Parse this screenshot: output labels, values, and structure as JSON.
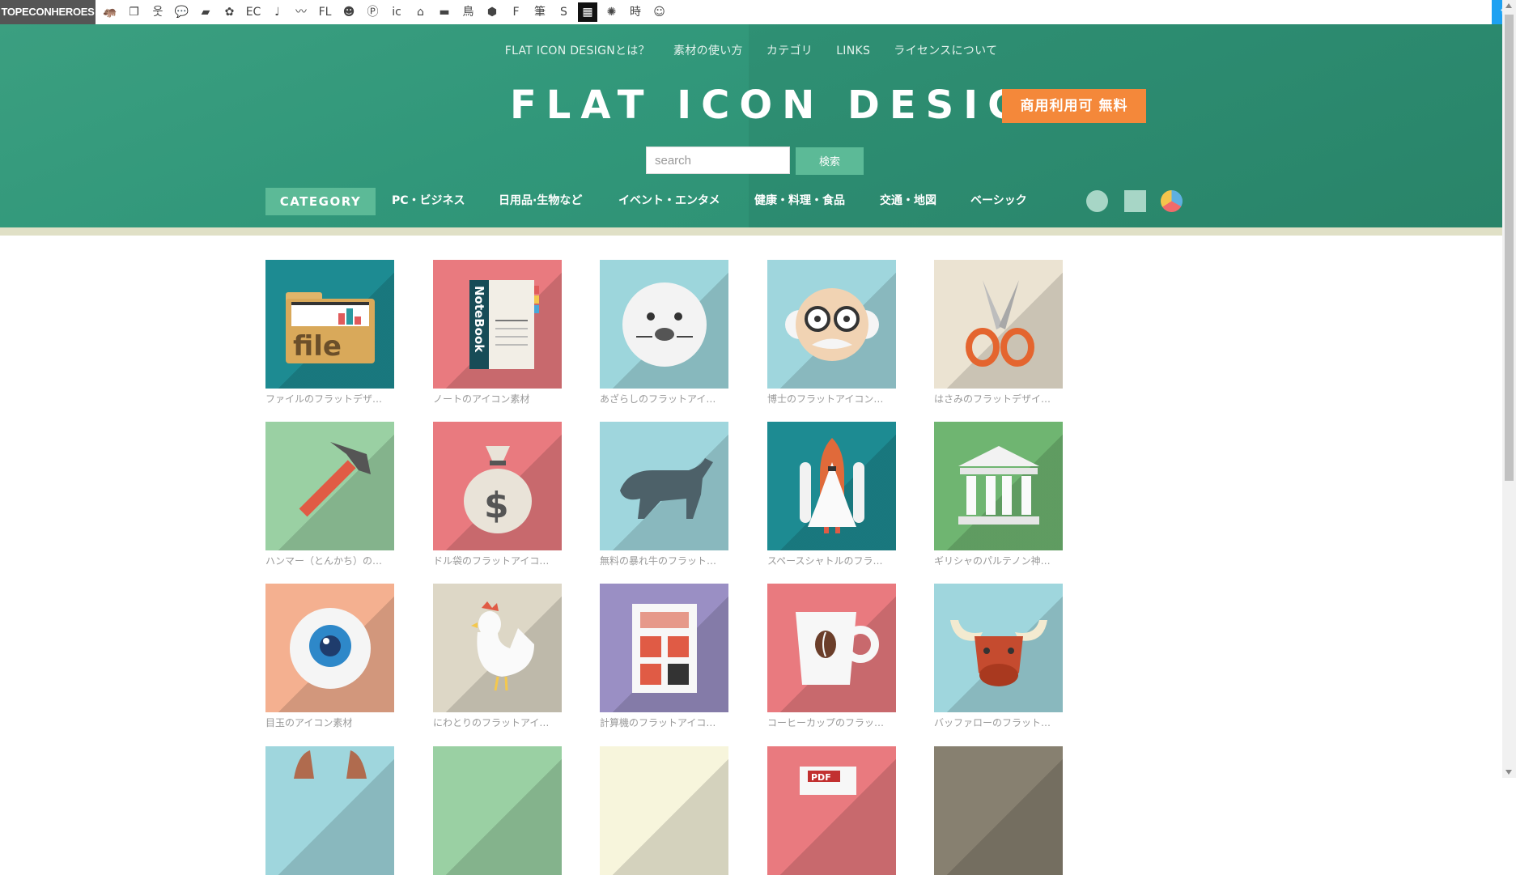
{
  "topbar": {
    "brand": "TOPECONHEROES",
    "icons": [
      {
        "name": "hippo-icon",
        "glyph": "🦛"
      },
      {
        "name": "copy-icon",
        "glyph": "❐"
      },
      {
        "name": "person-icon",
        "glyph": "웃"
      },
      {
        "name": "speech-bubble-icon",
        "glyph": "💬"
      },
      {
        "name": "card-icon",
        "glyph": "▰"
      },
      {
        "name": "flower-icon",
        "glyph": "✿"
      },
      {
        "name": "ec-icon",
        "glyph": "EC"
      },
      {
        "name": "music-note-icon",
        "glyph": "♩"
      },
      {
        "name": "line-icon",
        "glyph": "〰"
      },
      {
        "name": "flat-icon",
        "glyph": "FL"
      },
      {
        "name": "smiley-icon",
        "glyph": "☻"
      },
      {
        "name": "p-icon",
        "glyph": "Ⓟ"
      },
      {
        "name": "icon-text-icon",
        "glyph": "ic"
      },
      {
        "name": "building-icon",
        "glyph": "⌂"
      },
      {
        "name": "sofa-icon",
        "glyph": "▬"
      },
      {
        "name": "bird-icon",
        "glyph": "鳥"
      },
      {
        "name": "hexagon-icon",
        "glyph": "⬢"
      },
      {
        "name": "f-icon",
        "glyph": "F"
      },
      {
        "name": "brush-icon",
        "glyph": "筆"
      },
      {
        "name": "s-icon",
        "glyph": "S"
      },
      {
        "name": "grid-icon",
        "glyph": "▦"
      },
      {
        "name": "burst-icon",
        "glyph": "✺"
      },
      {
        "name": "time-icon",
        "glyph": "時"
      },
      {
        "name": "face-icon",
        "glyph": "☺"
      }
    ],
    "twitter": "t"
  },
  "nav": [
    "FLAT ICON DESIGNとは？",
    "素材の使い方",
    "カテゴリ",
    "LINKS",
    "ライセンスについて"
  ],
  "logo": "FLAT ICON DESIGN",
  "badge": "商用利用可 無料",
  "search": {
    "placeholder": "search",
    "button": "検索"
  },
  "category_label": "CATEGORY",
  "categories": [
    "PC・ビジネス",
    "日用品·生物など",
    "イベント・エンタメ",
    "健康・料理・食品",
    "交通・地図",
    "ベーシック"
  ],
  "tiles": [
    {
      "caption": "ファイルのフラットデザ…",
      "bg": "#1d8b92",
      "icon": "file-folder-icon"
    },
    {
      "caption": "ノートのアイコン素材",
      "bg": "#e97a7f",
      "icon": "notebook-icon"
    },
    {
      "caption": "あざらしのフラットアイ…",
      "bg": "#9dd6dc",
      "icon": "seal-icon"
    },
    {
      "caption": "博士のフラットアイコン…",
      "bg": "#9fd6dd",
      "icon": "professor-icon"
    },
    {
      "caption": "はさみのフラットデザイ…",
      "bg": "#ebe3d2",
      "icon": "scissors-icon"
    },
    {
      "caption": "ハンマー（とんかち）の…",
      "bg": "#9ad0a3",
      "icon": "hammer-icon"
    },
    {
      "caption": "ドル袋のフラットアイコ…",
      "bg": "#e97a7f",
      "icon": "money-bag-icon"
    },
    {
      "caption": "無料の暴れ牛のフラット…",
      "bg": "#9fd6dd",
      "icon": "bull-icon"
    },
    {
      "caption": "スペースシャトルのフラ…",
      "bg": "#1d8b92",
      "icon": "space-shuttle-icon"
    },
    {
      "caption": "ギリシャのパルテノン神…",
      "bg": "#6fb571",
      "icon": "parthenon-icon"
    },
    {
      "caption": "目玉のアイコン素材",
      "bg": "#f4b090",
      "icon": "eyeball-icon"
    },
    {
      "caption": "にわとりのフラットアイ…",
      "bg": "#ddd7c6",
      "icon": "chicken-icon"
    },
    {
      "caption": "計算機のフラットアイコ…",
      "bg": "#9a8fc4",
      "icon": "calculator-icon"
    },
    {
      "caption": "コーヒーカップのフラッ…",
      "bg": "#e97a7f",
      "icon": "coffee-cup-icon"
    },
    {
      "caption": "バッファローのフラット…",
      "bg": "#9fd6dd",
      "icon": "buffalo-icon"
    },
    {
      "caption": "",
      "bg": "#9fd6dd",
      "icon": "horns-icon"
    },
    {
      "caption": "",
      "bg": "#9ad0a3",
      "icon": "partial-icon"
    },
    {
      "caption": "",
      "bg": "#f7f5dc",
      "icon": "partial-icon"
    },
    {
      "caption": "",
      "bg": "#e97a7f",
      "icon": "pdf-icon"
    },
    {
      "caption": "",
      "bg": "#878070",
      "icon": "partial-icon"
    }
  ],
  "icon_text": {
    "file": "file",
    "notebook": "NoteBook",
    "dollar": "$",
    "pdf": "PDF"
  }
}
